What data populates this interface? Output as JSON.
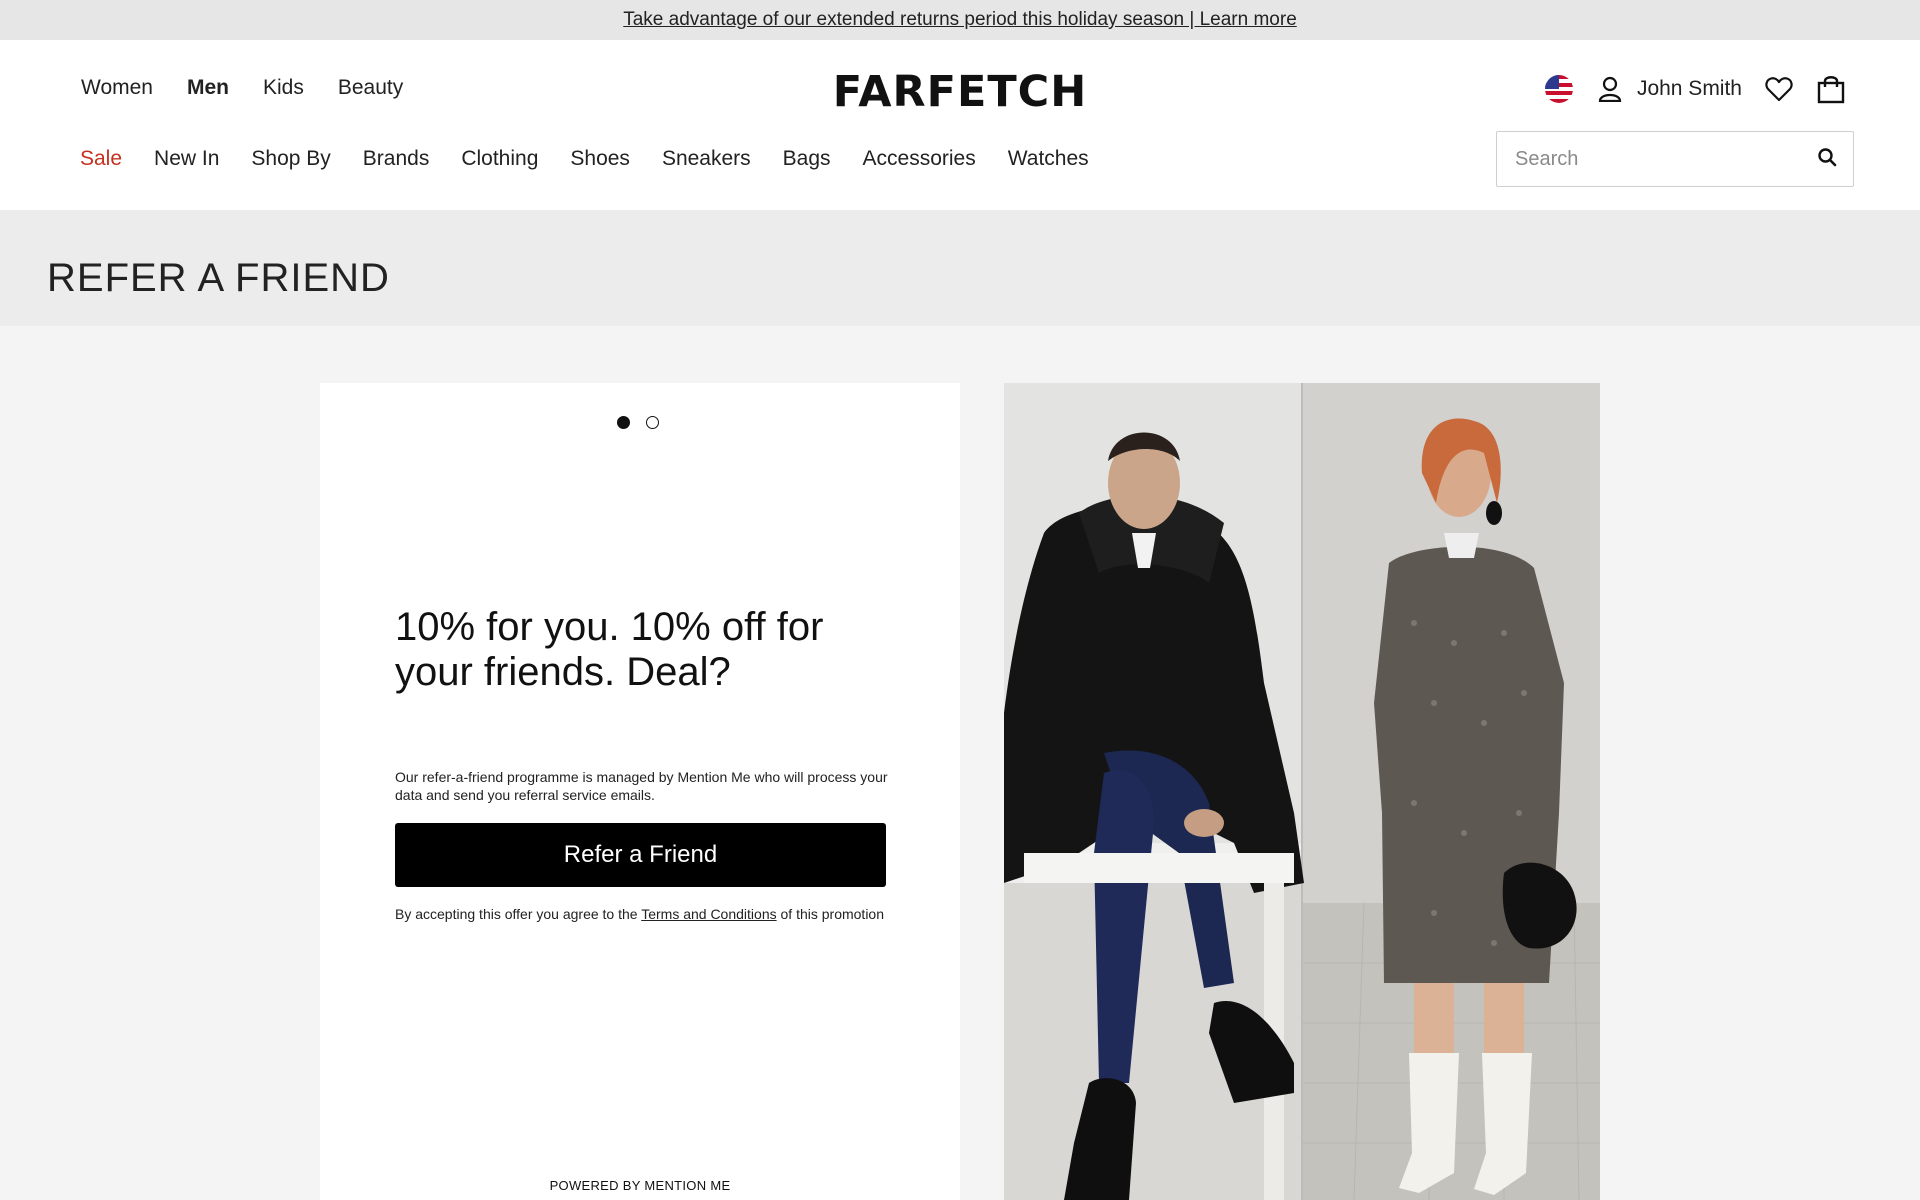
{
  "promo": {
    "text": "Take advantage of our extended returns period this holiday season | Learn more"
  },
  "header": {
    "gender_nav": [
      "Women",
      "Men",
      "Kids",
      "Beauty"
    ],
    "active_gender": "Men",
    "logo": "FARFETCH",
    "user_name": "John Smith",
    "category_nav": [
      "Sale",
      "New In",
      "Shop By",
      "Brands",
      "Clothing",
      "Shoes",
      "Sneakers",
      "Bags",
      "Accessories",
      "Watches"
    ],
    "search_placeholder": "Search"
  },
  "page": {
    "title": "REFER A FRIEND"
  },
  "refer_card": {
    "carousel": {
      "count": 2,
      "active": 1
    },
    "headline": "10% for you. 10% off for your friends. Deal?",
    "disclaimer": "Our refer-a-friend programme is managed by Mention Me who will process your data and send you referral service emails.",
    "button_label": "Refer a Friend",
    "terms_prefix": "By accepting this offer you agree to the ",
    "terms_link": "Terms and Conditions",
    "terms_suffix": " of this promotion",
    "powered_by": "POWERED BY MENTION ME"
  },
  "colors": {
    "sale": "#c4311f",
    "button": "#000000",
    "page_bg": "#f4f4f4",
    "title_strip": "#ececec"
  },
  "icons": [
    "us-flag-icon",
    "user-icon",
    "heart-icon",
    "bag-icon",
    "search-icon"
  ]
}
